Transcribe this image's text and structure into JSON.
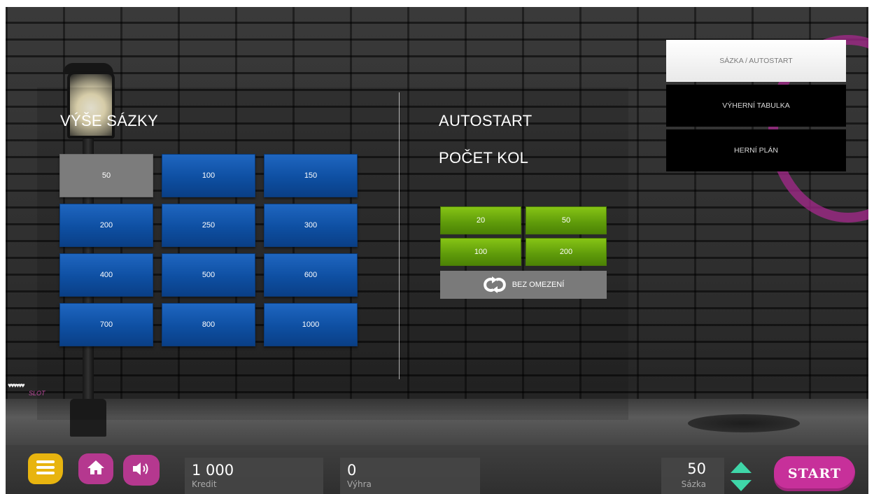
{
  "bet_section": {
    "title": "VÝŠE SÁZKY",
    "options": [
      "50",
      "100",
      "150",
      "200",
      "250",
      "300",
      "400",
      "500",
      "600",
      "700",
      "800",
      "1000"
    ],
    "selected": "50"
  },
  "autostart_section": {
    "title": "AUTOSTART",
    "rounds_title": "POČET KOL",
    "round_options": [
      "20",
      "50",
      "100",
      "200"
    ],
    "unlimited_label": "BEZ OMEZENÍ"
  },
  "menu": {
    "items": [
      "SÁZKA / AUTOSTART",
      "VÝHERNÍ TABULKA",
      "HERNÍ PLÁN"
    ],
    "active": "SÁZKA / AUTOSTART"
  },
  "brand": {
    "text": "SLOT"
  },
  "bottom_bar": {
    "credit_value": "1 000",
    "credit_label": "Kredit",
    "win_value": "0",
    "win_label": "Výhra",
    "bet_value": "50",
    "bet_label": "Sázka",
    "start_label": "START"
  },
  "icons": {
    "menu": "hamburger-icon",
    "home": "home-icon",
    "sound": "speaker-icon",
    "unlimited": "loop-icon"
  },
  "colors": {
    "bet_button": "#0e4fa2",
    "bet_selected": "#7c7c7c",
    "round_button": "#5e9a0a",
    "accent_pink": "#c7309a",
    "accent_yellow": "#e8b40f",
    "arrow_teal": "#3fd6a8"
  }
}
